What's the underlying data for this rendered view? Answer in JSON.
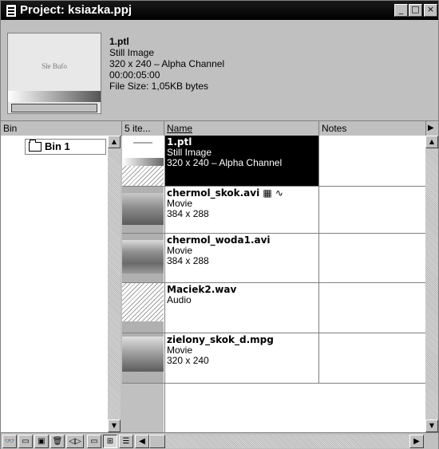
{
  "window": {
    "title": "Project: ksiazka.ppj",
    "minimize": "_",
    "maximize": "□",
    "close": "×"
  },
  "preview": {
    "thumb_text": "Słe Bufo",
    "file_name": "1.ptl",
    "type": "Still Image",
    "dimensions": "320 x 240 – Alpha Channel",
    "duration": "00:00:05:00",
    "file_size": "File Size: 1,05KB bytes"
  },
  "columns": {
    "bin": "Bin",
    "count": "5 ite...",
    "name": "Name",
    "notes": "Notes"
  },
  "bins": [
    {
      "label": "Bin 1"
    }
  ],
  "items": [
    {
      "name": "1.ptl",
      "type": "Still Image",
      "info": "320 x 240 – Alpha Channel",
      "selected": true
    },
    {
      "name": "chermol_skok.avi",
      "type": "Movie",
      "info": "384 x 288",
      "icons": [
        "film-icon",
        "audio-wave-icon"
      ]
    },
    {
      "name": "chermol_woda1.avi",
      "type": "Movie",
      "info": "384 x 288"
    },
    {
      "name": "Maciek2.wav",
      "type": "Audio",
      "info": ""
    },
    {
      "name": "zielony_skok_d.mpg",
      "type": "Movie",
      "info": "320 x 240"
    }
  ],
  "toolbar": {
    "icons": [
      "find-icon",
      "new-bin-icon",
      "new-item-icon",
      "trash-icon",
      "resize-divider-icon",
      "thumbnail-view-icon",
      "icon-view-icon",
      "list-view-icon"
    ]
  },
  "glyphs": {
    "up": "▲",
    "down": "▼",
    "left": "◀",
    "right": "▶",
    "find": "👓",
    "bin": "▭",
    "newitem": "▣",
    "trash": "🗑",
    "divider": "◁▷",
    "view1": "▭",
    "view2": "⊞",
    "view3": "☰",
    "film": "▦",
    "wave": "∿"
  }
}
